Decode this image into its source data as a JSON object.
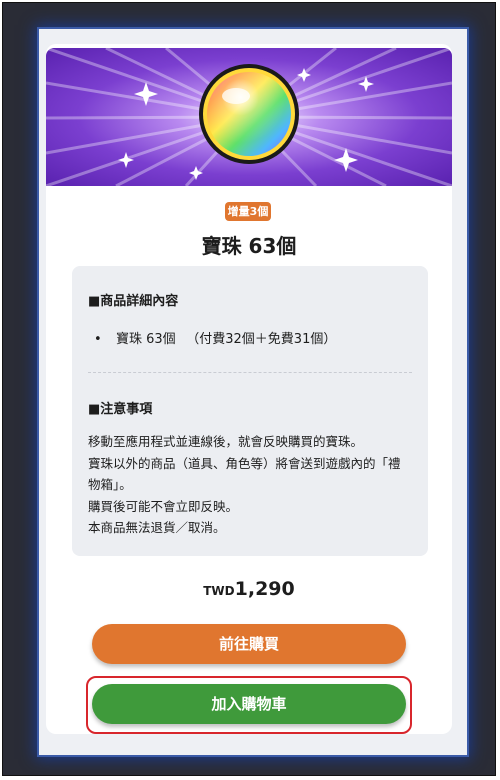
{
  "product": {
    "badge": "增量3個",
    "title": "寶珠 63個"
  },
  "details": {
    "section_title": "■商品詳細內容",
    "bullet": "•",
    "item_name": "寶珠 63個",
    "item_breakdown": "（付費32個＋免費31個）"
  },
  "notes": {
    "section_title": "■注意事項",
    "lines": [
      "移動至應用程式並連線後，就會反映購買的寶珠。",
      "寶珠以外的商品（道具、角色等）將會送到遊戲內的「禮",
      "物箱」。",
      "購買後可能不會立即反映。",
      "本商品無法退貨／取消。"
    ]
  },
  "price": {
    "currency": "TWD",
    "amount": "1,290"
  },
  "buttons": {
    "buy_label": "前往購買",
    "cart_label": "加入購物車"
  },
  "colors": {
    "accent_orange": "#e0762f",
    "accent_green": "#3f9a3b",
    "highlight_red": "#d8262c",
    "banner_purple": "#7b3fd0"
  },
  "icons": {
    "banner": "rainbow-orb-icon"
  }
}
